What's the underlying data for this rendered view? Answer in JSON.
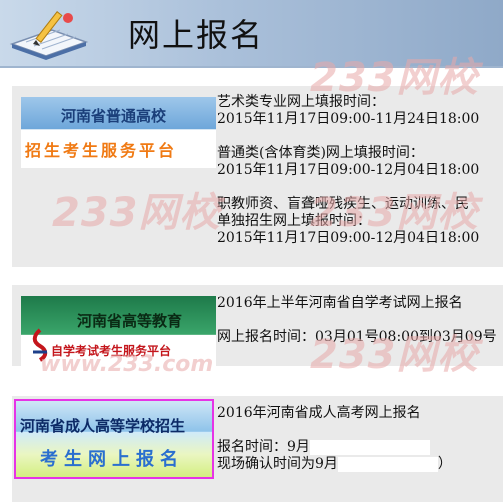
{
  "header": {
    "title": "网上报名"
  },
  "watermark": {
    "brand": "233网校",
    "url": "www.233.com"
  },
  "panels": [
    {
      "banner": {
        "line1": "河南省普通高校",
        "line2": "招生考生服务平台"
      },
      "info": [
        "艺术类专业网上填报时间：",
        "2015年11月17日09:00-11月24日18:00",
        "",
        "普通类(含体育类)网上填报时间：",
        "2015年11月17日09:00-12月04日18:00",
        "",
        "职教师资、盲聋哑残疾生、运动训练、民",
        "单独招生网上填报时间：",
        "2015年11月17日09:00-12月04日18:00"
      ]
    },
    {
      "banner": {
        "line1": "河南省高等教育",
        "line2": "自学考试考生服务平台"
      },
      "info": [
        "2016年上半年河南省自学考试网上报名",
        "",
        "网上报名时间：03月01号08:00到03月09号"
      ]
    },
    {
      "banner": {
        "line1": "河南省成人高等学校招生",
        "line2": "考生网上报名"
      },
      "info": [
        "2016年河南省成人高考网上报名",
        "",
        "报名时间：9月",
        "现场确认时间为9月"
      ],
      "closing_paren": "）"
    }
  ]
}
